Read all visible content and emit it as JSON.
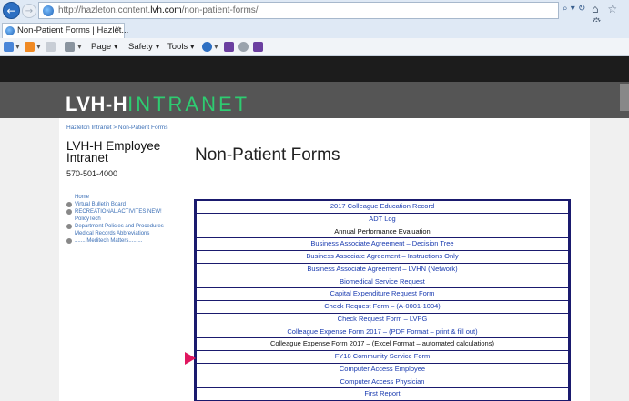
{
  "browser": {
    "url_prefix": "http://hazleton.content.",
    "url_domain": "lvh.com",
    "url_path": "/non-patient-forms/",
    "tab_title": "Non-Patient Forms | Hazlet...",
    "commands": {
      "page": "Page ▾",
      "safety": "Safety ▾",
      "tools": "Tools ▾"
    }
  },
  "site": {
    "logo_left": "LVH-H",
    "logo_right": "INTRANET",
    "breadcrumb": "Hazleton Intranet > Non-Patient Forms",
    "brand_title": "LVH-H Employee Intranet",
    "phone": "570-501-4000",
    "page_title": "Non-Patient Forms"
  },
  "sidebar": {
    "items": [
      {
        "label": "Home",
        "bullet": false
      },
      {
        "label": "Virtual Bulletin Board",
        "bullet": true
      },
      {
        "label": "RECREATIONAL ACTIVITES NEW!",
        "bullet": true
      },
      {
        "label": "PolicyTech",
        "bullet": false
      },
      {
        "label": "Department Policies and Procedures",
        "bullet": true
      },
      {
        "label": "Medical Records Abbreviations",
        "bullet": false
      },
      {
        "label": "........Meditech Matters.........",
        "bullet": true
      }
    ]
  },
  "forms": [
    {
      "label": "2017 Colleague Education Record",
      "link": true
    },
    {
      "label": "ADT Log",
      "link": true
    },
    {
      "label": "Annual Performance Evaluation",
      "link": false
    },
    {
      "label": "Business Associate Agreement – Decision Tree",
      "link": true
    },
    {
      "label": "Business Associate Agreement – Instructions Only",
      "link": true
    },
    {
      "label": "Business Associate Agreement – LVHN (Network)",
      "link": true
    },
    {
      "label": "Biomedical Service Request",
      "link": true
    },
    {
      "label": "Capital Expenditure Request Form",
      "link": true
    },
    {
      "label": "Check Request Form – (A-0001-1004)",
      "link": true
    },
    {
      "label": "Check Request Form – LVPG",
      "link": true
    },
    {
      "label": "Colleague Expense Form 2017 – (PDF Format – print & fill out)",
      "link": true
    },
    {
      "label": "Colleague Expense Form 2017 – (Excel Format – automated calculations)",
      "link": false
    },
    {
      "label": "FY18 Community Service Form",
      "link": true
    },
    {
      "label": "Computer Access Employee",
      "link": true
    },
    {
      "label": "Computer Access Physician",
      "link": true
    },
    {
      "label": "First Report",
      "link": true
    }
  ],
  "colors": {
    "accent_green": "#2ecc71",
    "link_blue": "#1a3bb0",
    "table_border": "#1a1a6e",
    "pointer": "#e0175f"
  }
}
